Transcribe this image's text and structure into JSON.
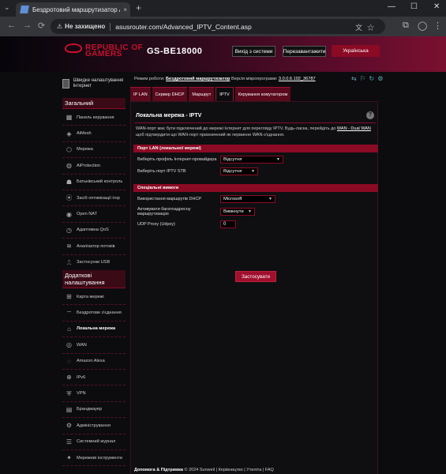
{
  "browser": {
    "tab_title": "Бездротовий маршрутизатор А",
    "tab_close": "×",
    "new_tab": "+",
    "tab_list": "⌄",
    "security_label": "Не захищено",
    "url": "asusrouter.com/Advanced_IPTV_Content.asp",
    "window_minimize": "—",
    "window_maximize": "☐",
    "window_close": "✕",
    "back": "←",
    "forward": "→",
    "reload": "⟳",
    "omnibox_icons": "文☆",
    "extensions": "⧉",
    "profile": "◯",
    "menu": "⋮"
  },
  "header": {
    "brand_line1": "REPUBLIC OF",
    "brand_line2": "GAMERS",
    "model": "GS-BE18000",
    "logout": "Вихід з системи",
    "reboot": "Перезавантажити",
    "language": "Українська"
  },
  "status": {
    "mode_label": "Режим роботи:",
    "mode_value": "Бездротовий маршрутизатор",
    "fw_label": "Версія мікропрограми:",
    "fw_value": "3.0.0.6.102_36787",
    "icons": "⇆ ⚐ ↻ ⚙"
  },
  "sidebar": {
    "qis_label": "Швидке налаштування Інтернет",
    "general_header": "Загальний",
    "general_items": [
      {
        "label": "Панель керування",
        "icon": "▦"
      },
      {
        "label": "AiMesh",
        "icon": "◈"
      },
      {
        "label": "Мережа",
        "icon": "⬡"
      },
      {
        "label": "AiProtection",
        "icon": "◍"
      },
      {
        "label": "Батьківський контроль",
        "icon": "☗"
      },
      {
        "label": "Засіб оптимізації ігор",
        "icon": "⦿"
      },
      {
        "label": "Open NAT",
        "icon": "◉"
      },
      {
        "label": "Адаптивна QoS",
        "icon": "◷"
      },
      {
        "label": "Аналізатор потоків",
        "icon": "≋"
      },
      {
        "label": "Застосунки USB",
        "icon": "⎍"
      }
    ],
    "advanced_header": "Додаткові налаштування",
    "advanced_items": [
      {
        "label": "Карта мережі",
        "icon": "⊞",
        "active": false
      },
      {
        "label": "Бездротове з'єднання",
        "icon": "⌔",
        "active": false
      },
      {
        "label": "Локальна мережа",
        "icon": "⌂",
        "active": true
      },
      {
        "label": "WAN",
        "icon": "◎",
        "active": false
      },
      {
        "label": "Amazon Alexa",
        "icon": "◌",
        "active": false
      },
      {
        "label": "IPv6",
        "icon": "⊕",
        "active": false
      },
      {
        "label": "VPN",
        "icon": "⛨",
        "active": false
      },
      {
        "label": "Брандмауер",
        "icon": "▤",
        "active": false
      },
      {
        "label": "Адміністрування",
        "icon": "⚙",
        "active": false
      },
      {
        "label": "Системний журнал",
        "icon": "☰",
        "active": false
      },
      {
        "label": "Мережеві інструменти",
        "icon": "✦",
        "active": false
      }
    ]
  },
  "tabs": [
    {
      "label": "IP LAN",
      "active": false
    },
    {
      "label": "Сервер DHCP",
      "active": false
    },
    {
      "label": "Маршрут",
      "active": false
    },
    {
      "label": "IPTV",
      "active": true
    },
    {
      "label": "Керування комутатором",
      "active": false
    }
  ],
  "panel": {
    "title": "Локальна мережа - IPTV",
    "help": "?",
    "description_1": "WAN-порт має бути підключений до мережі Інтернет для перегляду IPTV. Будь-ласка, перейдіть до ",
    "description_link": "WAN - Dual WAN",
    "description_2": " щоб підтвердити що WAN-порт призначений як первинне WAN-з'єднання.",
    "lan_port_header": "Порт LAN (локальної мережі)",
    "isp_profile_label": "Виберіть профіль Інтернет-провайдера",
    "isp_profile_value": "Відсутня",
    "iptv_stb_label": "Виберіть порт IPTV STB",
    "iptv_stb_value": "Відсутня",
    "special_header": "Спеціальні вимоги",
    "dhcp_routes_label": "Використання маршрутів DHCP",
    "dhcp_routes_value": "Microsoft",
    "multicast_label": "Активувати багатоадресну маршрутизацію",
    "multicast_value": "Вимкнути",
    "udp_proxy_label": "UDP Proxy (Udpxy)",
    "udp_proxy_value": "0",
    "apply": "Застосувати"
  },
  "footer": {
    "help_label": "Допомога & Підтримка",
    "links": "© 2024 Sunweil | Керівництво | Утиліта | FAQ"
  }
}
